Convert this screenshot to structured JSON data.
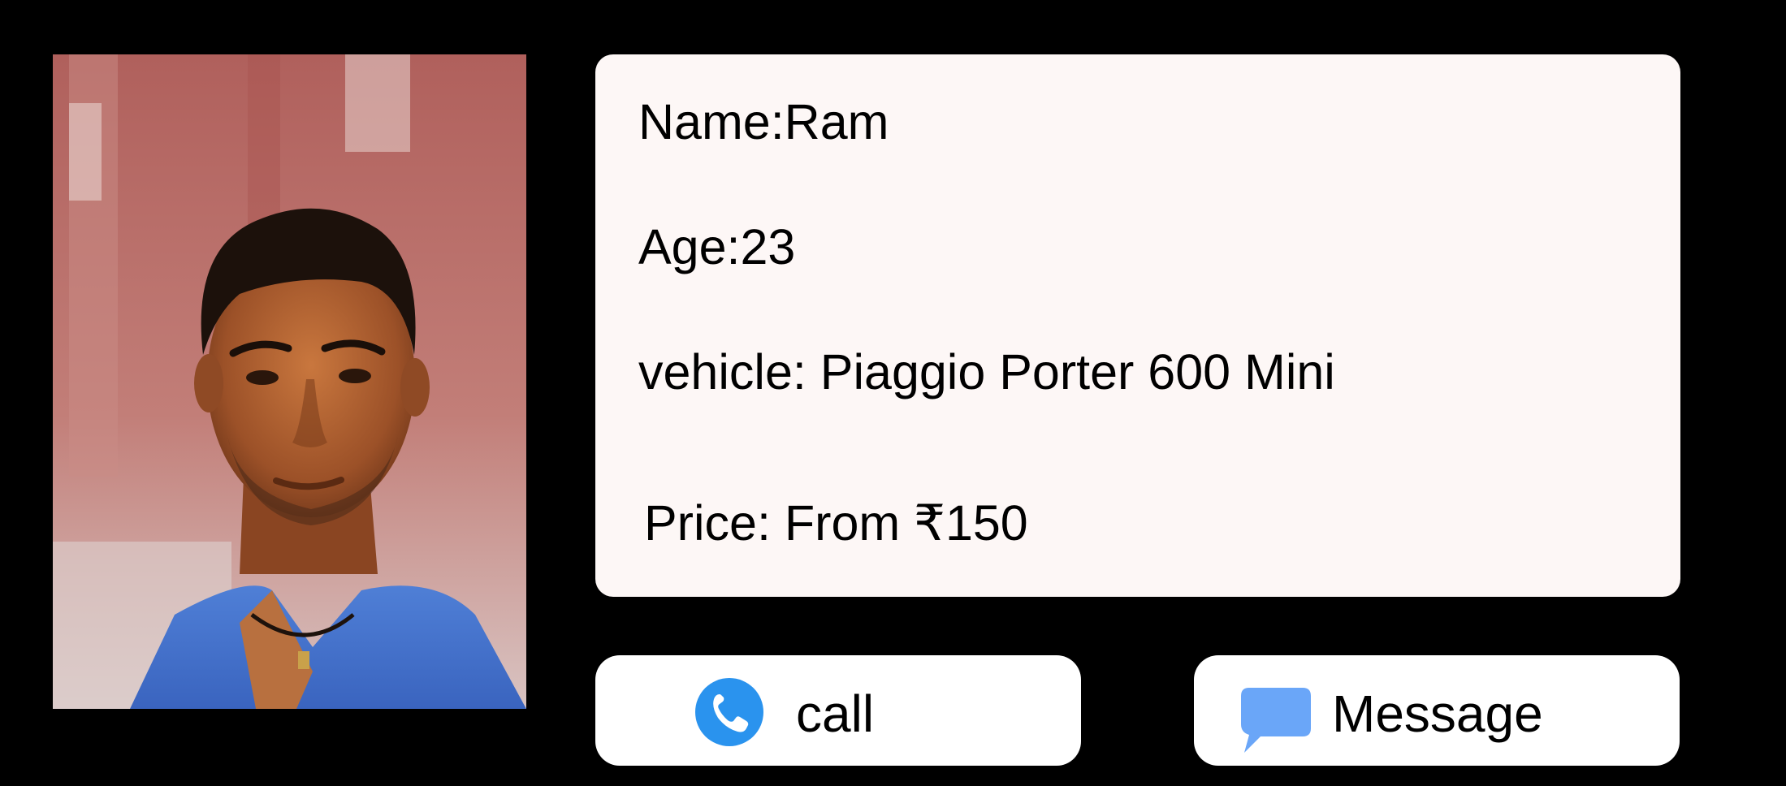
{
  "driver": {
    "name_line": "Name:Ram",
    "age_line": "Age:23",
    "vehicle_line": "vehicle: Piaggio Porter 600 Mini",
    "price_line": "Price: From ₹150"
  },
  "actions": {
    "call_label": "call",
    "call_icon": "phone-icon",
    "message_label": "Message",
    "message_icon": "chat-bubble-icon"
  },
  "colors": {
    "background": "#000000",
    "card": "#fdf7f6",
    "button": "#ffffff",
    "call_icon": "#2a93ee",
    "message_icon": "#6aa6f8"
  }
}
